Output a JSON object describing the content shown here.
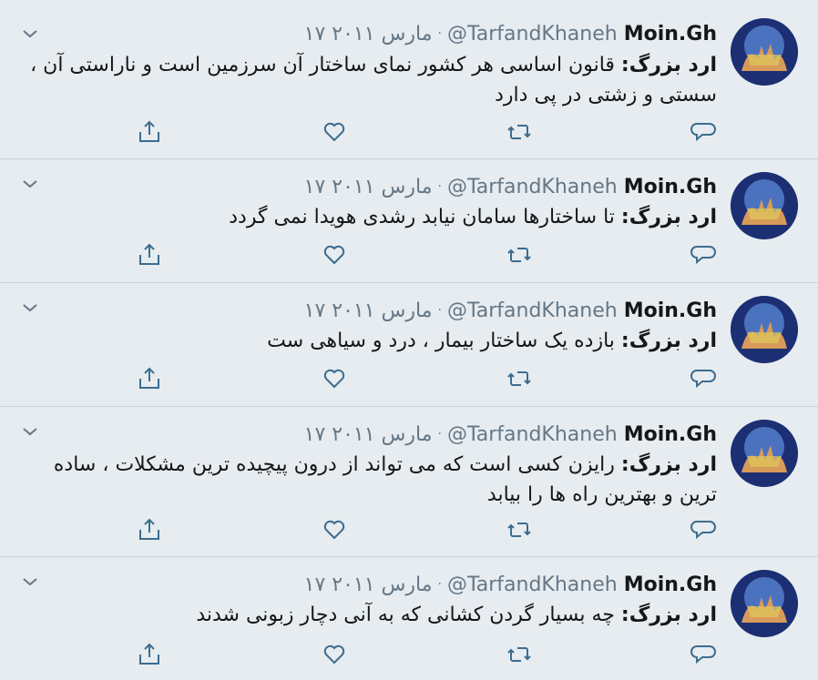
{
  "tweets": [
    {
      "display_name": "Moin.Gh",
      "handle": "@TarfandKhaneh",
      "separator": "·",
      "date": "۱۷ مارس ۲۰۱۱",
      "author_prefix": "ارد بزرگ:",
      "text": " قانون اساسی هر کشور نمای ساختار آن سرزمین است و ناراستی آن ، سستی و  زشتی در پی دارد"
    },
    {
      "display_name": "Moin.Gh",
      "handle": "@TarfandKhaneh",
      "separator": "·",
      "date": "۱۷ مارس ۲۰۱۱",
      "author_prefix": "ارد بزرگ:",
      "text": " تا ساختارها سامان نیابد رشدی هویدا نمی گردد"
    },
    {
      "display_name": "Moin.Gh",
      "handle": "@TarfandKhaneh",
      "separator": "·",
      "date": "۱۷ مارس ۲۰۱۱",
      "author_prefix": "ارد بزرگ:",
      "text": " بازده یک ساختار بیمار ، درد و سیاهی ست"
    },
    {
      "display_name": "Moin.Gh",
      "handle": "@TarfandKhaneh",
      "separator": "·",
      "date": "۱۷ مارس ۲۰۱۱",
      "author_prefix": "ارد بزرگ:",
      "text": " رایزن کسی است که می تواند از درون پیچیده ترین مشکلات ، ساده ترین و بهترین راه ها را بیابد"
    },
    {
      "display_name": "Moin.Gh",
      "handle": "@TarfandKhaneh",
      "separator": "·",
      "date": "۱۷ مارس ۲۰۱۱",
      "author_prefix": "ارد بزرگ:",
      "text": " چه بسیار گردن کشانی که به آنی دچار  زبونی شدند"
    }
  ],
  "icons": {
    "reply": "reply-icon",
    "retweet": "retweet-icon",
    "like": "heart-icon",
    "share": "share-icon",
    "menu": "chevron-down-icon",
    "avatar": "avatar"
  },
  "colors": {
    "background": "#e6ecf0",
    "text": "#14171a",
    "secondary": "#657786",
    "icon": "#3c6d8f",
    "divider": "#c9d3da"
  }
}
